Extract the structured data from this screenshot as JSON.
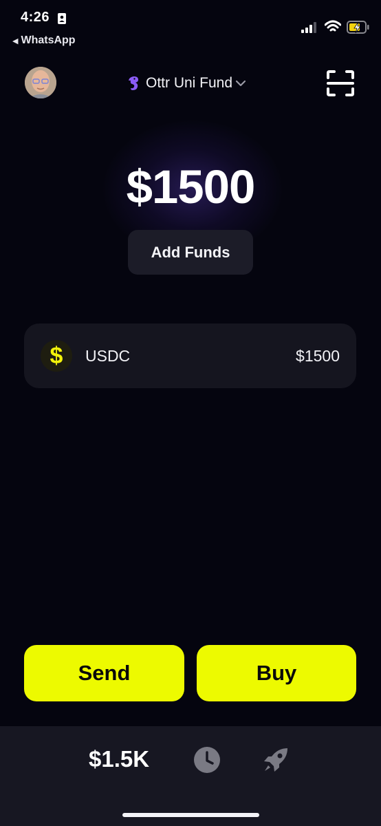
{
  "status_bar": {
    "time": "4:26",
    "back_label": "WhatsApp",
    "back_arrow": "◀"
  },
  "header": {
    "fund_name": "Ottr Uni Fund",
    "fund_icon": "seahorse-icon",
    "dropdown_icon": "chevron-down-icon",
    "scan_icon": "scan-icon"
  },
  "wallet": {
    "balance": "$1500",
    "add_funds_label": "Add Funds"
  },
  "assets": [
    {
      "symbol": "$",
      "name": "USDC",
      "value": "$1500",
      "icon_color": "#f2f20a"
    }
  ],
  "actions": {
    "send_label": "Send",
    "buy_label": "Buy",
    "accent_color": "#edfa00"
  },
  "bottom_nav": {
    "balance_short": "$1.5K",
    "items": [
      "balance",
      "clock-icon",
      "rocket-icon"
    ]
  }
}
